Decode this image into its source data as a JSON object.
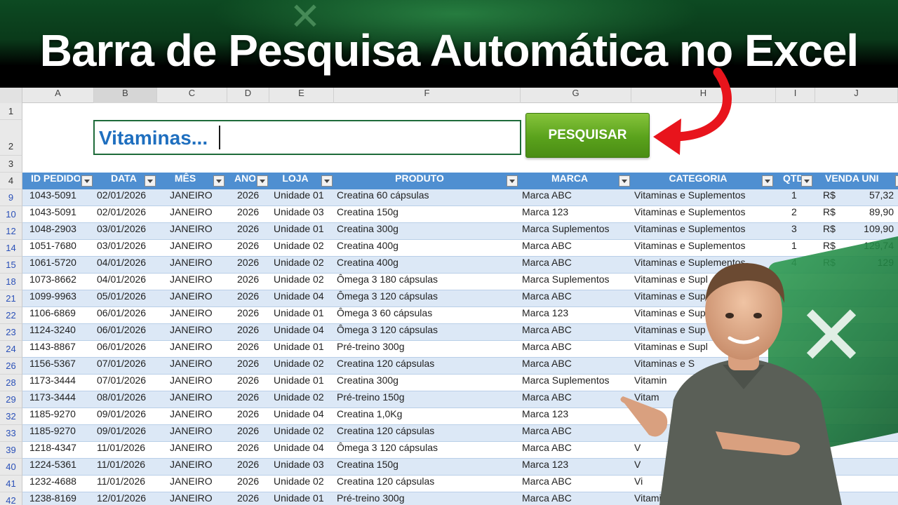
{
  "title": "Barra de Pesquisa Automática no Excel",
  "columns": [
    "A",
    "B",
    "C",
    "D",
    "E",
    "F",
    "G",
    "H",
    "I",
    "J"
  ],
  "row_numbers_top": [
    "1",
    "2",
    "3",
    "4"
  ],
  "search": {
    "value": "Vitaminas...",
    "button_label": "PESQUISAR"
  },
  "table": {
    "headers": [
      "ID PEDIDO",
      "DATA",
      "MÊS",
      "ANO",
      "LOJA",
      "PRODUTO",
      "MARCA",
      "CATEGORIA",
      "QTD",
      "VENDA UNI"
    ],
    "rows": [
      {
        "n": "9",
        "id": "1043-5091",
        "data": "02/01/2026",
        "mes": "JANEIRO",
        "ano": "2026",
        "loja": "Unidade 01",
        "produto": "Creatina 60 cápsulas",
        "marca": "Marca ABC",
        "categoria": "Vitaminas e Suplementos",
        "qtd": "1",
        "rs": "R$",
        "venda": "57,32"
      },
      {
        "n": "10",
        "id": "1043-5091",
        "data": "02/01/2026",
        "mes": "JANEIRO",
        "ano": "2026",
        "loja": "Unidade 03",
        "produto": "Creatina 150g",
        "marca": "Marca 123",
        "categoria": "Vitaminas e Suplementos",
        "qtd": "2",
        "rs": "R$",
        "venda": "89,90"
      },
      {
        "n": "12",
        "id": "1048-2903",
        "data": "03/01/2026",
        "mes": "JANEIRO",
        "ano": "2026",
        "loja": "Unidade 01",
        "produto": "Creatina 300g",
        "marca": "Marca Suplementos",
        "categoria": "Vitaminas e Suplementos",
        "qtd": "3",
        "rs": "R$",
        "venda": "109,90"
      },
      {
        "n": "14",
        "id": "1051-7680",
        "data": "03/01/2026",
        "mes": "JANEIRO",
        "ano": "2026",
        "loja": "Unidade 02",
        "produto": "Creatina 400g",
        "marca": "Marca ABC",
        "categoria": "Vitaminas e Suplementos",
        "qtd": "1",
        "rs": "R$",
        "venda": "129,74"
      },
      {
        "n": "15",
        "id": "1061-5720",
        "data": "04/01/2026",
        "mes": "JANEIRO",
        "ano": "2026",
        "loja": "Unidade 02",
        "produto": "Creatina 400g",
        "marca": "Marca ABC",
        "categoria": "Vitaminas e Suplementos",
        "qtd": "4",
        "rs": "R$",
        "venda": "129"
      },
      {
        "n": "18",
        "id": "1073-8662",
        "data": "04/01/2026",
        "mes": "JANEIRO",
        "ano": "2026",
        "loja": "Unidade 02",
        "produto": "Ômega 3 180 cápsulas",
        "marca": "Marca Suplementos",
        "categoria": "Vitaminas e Supl",
        "qtd": "",
        "rs": "",
        "venda": ""
      },
      {
        "n": "21",
        "id": "1099-9963",
        "data": "05/01/2026",
        "mes": "JANEIRO",
        "ano": "2026",
        "loja": "Unidade 04",
        "produto": "Ômega 3 120 cápsulas",
        "marca": "Marca ABC",
        "categoria": "Vitaminas e Sup",
        "qtd": "",
        "rs": "",
        "venda": ""
      },
      {
        "n": "22",
        "id": "1106-6869",
        "data": "06/01/2026",
        "mes": "JANEIRO",
        "ano": "2026",
        "loja": "Unidade 01",
        "produto": "Ômega 3 60 cápsulas",
        "marca": "Marca 123",
        "categoria": "Vitaminas e Sup",
        "qtd": "",
        "rs": "",
        "venda": ""
      },
      {
        "n": "23",
        "id": "1124-3240",
        "data": "06/01/2026",
        "mes": "JANEIRO",
        "ano": "2026",
        "loja": "Unidade 04",
        "produto": "Ômega 3 120 cápsulas",
        "marca": "Marca ABC",
        "categoria": "Vitaminas e Sup",
        "qtd": "",
        "rs": "",
        "venda": ""
      },
      {
        "n": "24",
        "id": "1143-8867",
        "data": "06/01/2026",
        "mes": "JANEIRO",
        "ano": "2026",
        "loja": "Unidade 01",
        "produto": "Pré-treino 300g",
        "marca": "Marca ABC",
        "categoria": "Vitaminas e Supl",
        "qtd": "",
        "rs": "",
        "venda": ""
      },
      {
        "n": "26",
        "id": "1156-5367",
        "data": "07/01/2026",
        "mes": "JANEIRO",
        "ano": "2026",
        "loja": "Unidade 02",
        "produto": "Creatina 120 cápsulas",
        "marca": "Marca ABC",
        "categoria": "Vitaminas e S",
        "qtd": "",
        "rs": "",
        "venda": ""
      },
      {
        "n": "28",
        "id": "1173-3444",
        "data": "07/01/2026",
        "mes": "JANEIRO",
        "ano": "2026",
        "loja": "Unidade 01",
        "produto": "Creatina 300g",
        "marca": "Marca Suplementos",
        "categoria": "Vitamin",
        "qtd": "",
        "rs": "",
        "venda": ""
      },
      {
        "n": "29",
        "id": "1173-3444",
        "data": "08/01/2026",
        "mes": "JANEIRO",
        "ano": "2026",
        "loja": "Unidade 02",
        "produto": "Pré-treino 150g",
        "marca": "Marca ABC",
        "categoria": "Vitam",
        "qtd": "",
        "rs": "",
        "venda": ""
      },
      {
        "n": "32",
        "id": "1185-9270",
        "data": "09/01/2026",
        "mes": "JANEIRO",
        "ano": "2026",
        "loja": "Unidade 04",
        "produto": "Creatina 1,0Kg",
        "marca": "Marca 123",
        "categoria": "",
        "qtd": "",
        "rs": "",
        "venda": ""
      },
      {
        "n": "33",
        "id": "1185-9270",
        "data": "09/01/2026",
        "mes": "JANEIRO",
        "ano": "2026",
        "loja": "Unidade 02",
        "produto": "Creatina 120 cápsulas",
        "marca": "Marca ABC",
        "categoria": "",
        "qtd": "",
        "rs": "",
        "venda": ""
      },
      {
        "n": "39",
        "id": "1218-4347",
        "data": "11/01/2026",
        "mes": "JANEIRO",
        "ano": "2026",
        "loja": "Unidade 04",
        "produto": "Ômega 3 120 cápsulas",
        "marca": "Marca ABC",
        "categoria": "V",
        "qtd": "",
        "rs": "",
        "venda": ""
      },
      {
        "n": "40",
        "id": "1224-5361",
        "data": "11/01/2026",
        "mes": "JANEIRO",
        "ano": "2026",
        "loja": "Unidade 03",
        "produto": "Creatina 150g",
        "marca": "Marca 123",
        "categoria": "V",
        "qtd": "",
        "rs": "",
        "venda": ""
      },
      {
        "n": "41",
        "id": "1232-4688",
        "data": "11/01/2026",
        "mes": "JANEIRO",
        "ano": "2026",
        "loja": "Unidade 02",
        "produto": "Creatina 120 cápsulas",
        "marca": "Marca ABC",
        "categoria": "Vi",
        "qtd": "",
        "rs": "",
        "venda": ""
      },
      {
        "n": "42",
        "id": "1238-8169",
        "data": "12/01/2026",
        "mes": "JANEIRO",
        "ano": "2026",
        "loja": "Unidade 01",
        "produto": "Pré-treino 300g",
        "marca": "Marca ABC",
        "categoria": "Vitamin",
        "qtd": "",
        "rs": "",
        "venda": ""
      }
    ]
  },
  "colors": {
    "table_header": "#4f8fd1",
    "row_band": "#dce8f6",
    "button_green": "#5aa21c",
    "search_text": "#1f6fbf",
    "arrow_red": "#e8141c"
  }
}
